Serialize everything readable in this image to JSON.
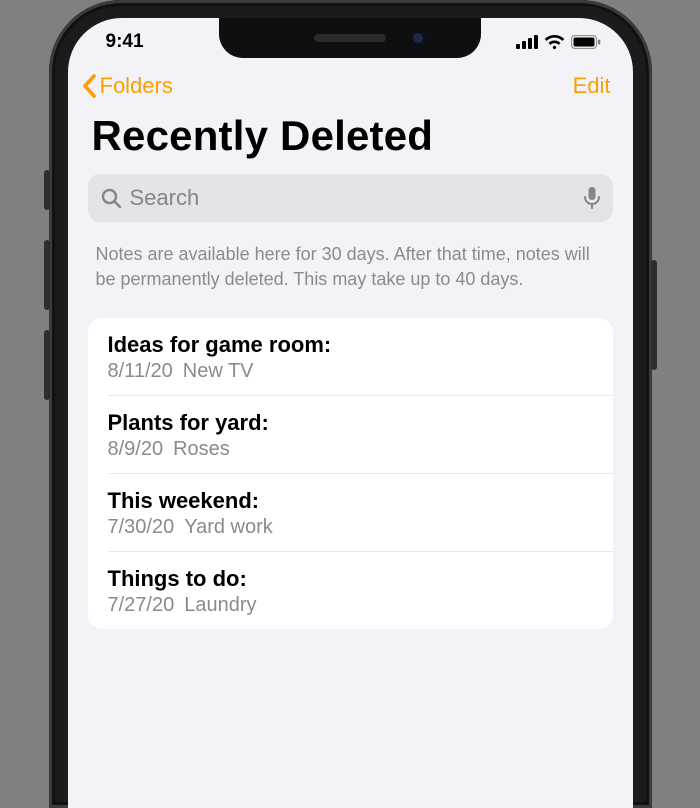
{
  "status": {
    "time": "9:41"
  },
  "nav": {
    "back_label": "Folders",
    "edit_label": "Edit"
  },
  "page": {
    "title": "Recently Deleted"
  },
  "search": {
    "placeholder": "Search"
  },
  "info": {
    "text": "Notes are available here for 30 days. After that time, notes will be permanently deleted. This may take up to 40 days."
  },
  "notes": [
    {
      "title": "Ideas for game room:",
      "date": "8/11/20",
      "preview": "New TV"
    },
    {
      "title": "Plants for yard:",
      "date": "8/9/20",
      "preview": "Roses"
    },
    {
      "title": "This weekend:",
      "date": "7/30/20",
      "preview": "Yard work"
    },
    {
      "title": "Things to do:",
      "date": "7/27/20",
      "preview": "Laundry"
    }
  ]
}
